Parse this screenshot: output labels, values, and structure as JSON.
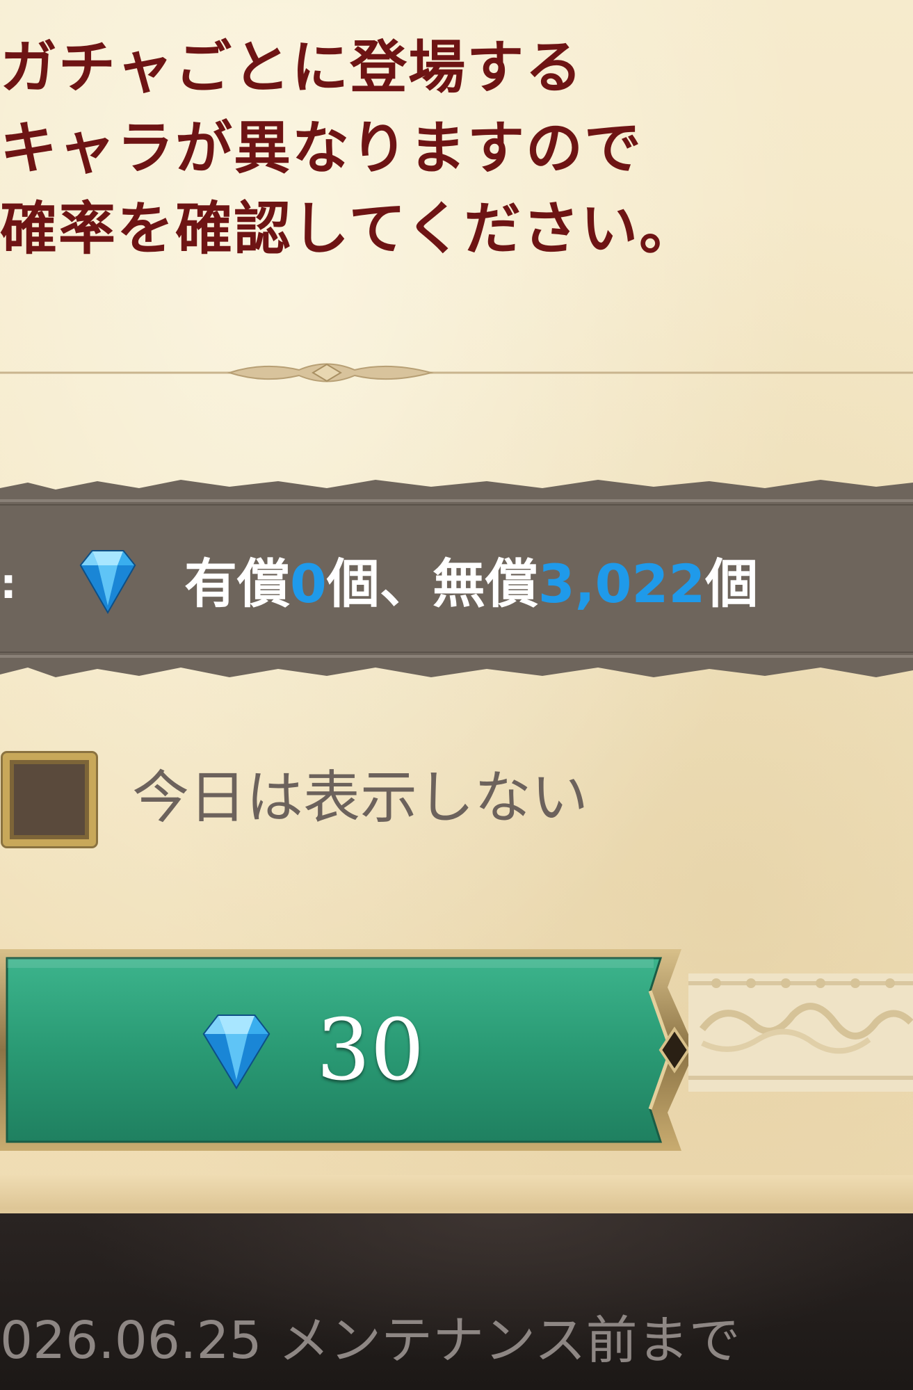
{
  "notice": {
    "lines": [
      "ガチャごとに登場する",
      "キャラが異なりますので",
      "確率を確認してください。"
    ]
  },
  "balance": {
    "prefix": ":",
    "paid_label": "有償",
    "paid_count": "0",
    "unit_1": "個、",
    "free_label": "無償",
    "free_count": "3,022",
    "unit_2": "個"
  },
  "dont_show_today": {
    "label": "今日は表示しない",
    "checked": false
  },
  "gacha_button": {
    "cost": "30",
    "icon": "gem-icon"
  },
  "footer": {
    "period": "026.06.25 メンテナンス前まで"
  },
  "colors": {
    "notice_text": "#6e1414",
    "count_blue": "#1f9aea",
    "button_green": "#2aa07a",
    "band_brown": "#6e655c"
  }
}
